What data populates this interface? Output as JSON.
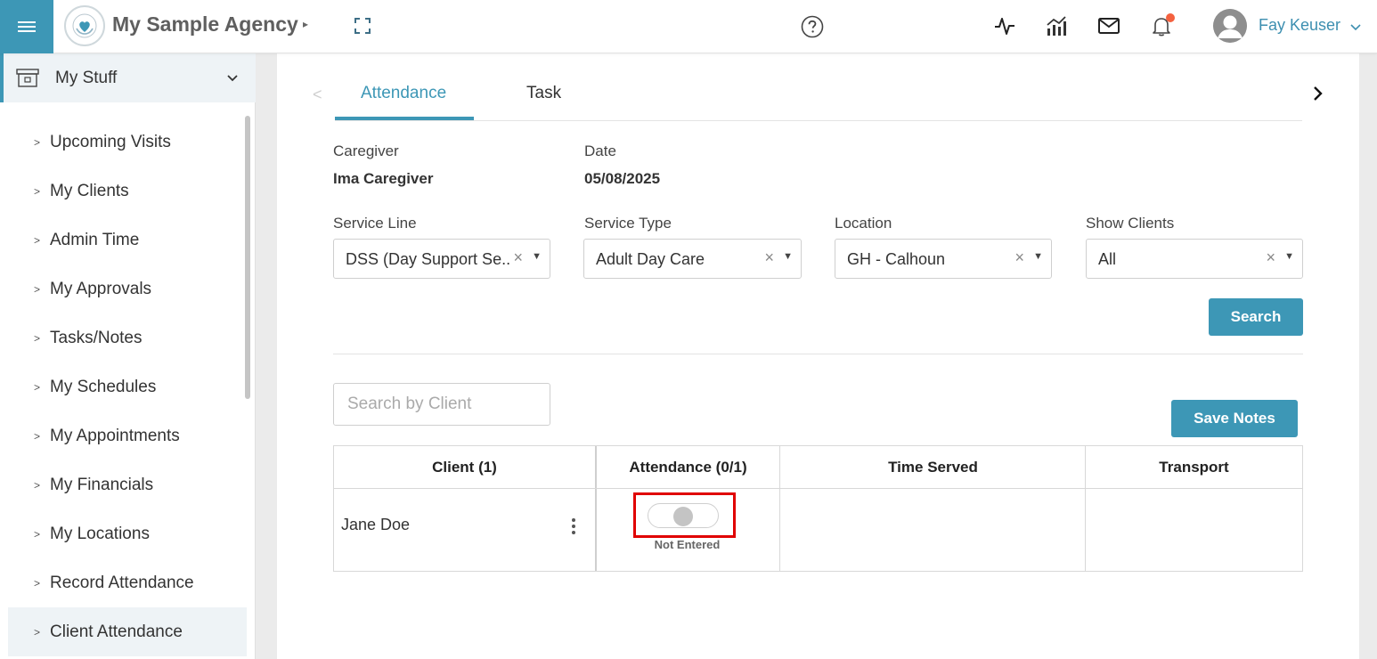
{
  "header": {
    "agency_name": "My Sample Agency",
    "user_name": "Fay Keuser",
    "accent_color": "#3d97b6",
    "notification_dot_color": "#f4613f"
  },
  "sidebar": {
    "section_label": "My Stuff",
    "items": [
      {
        "label": "Upcoming Visits"
      },
      {
        "label": "My Clients"
      },
      {
        "label": "Admin Time"
      },
      {
        "label": "My Approvals"
      },
      {
        "label": "Tasks/Notes"
      },
      {
        "label": "My Schedules"
      },
      {
        "label": "My Appointments"
      },
      {
        "label": "My Financials"
      },
      {
        "label": "My Locations"
      },
      {
        "label": "Record Attendance"
      },
      {
        "label": "Client Attendance"
      }
    ],
    "active_item": "Client Attendance"
  },
  "tabs": [
    {
      "label": "Attendance",
      "active": true
    },
    {
      "label": "Task",
      "active": false
    }
  ],
  "info": {
    "caregiver_label": "Caregiver",
    "caregiver_value": "Ima Caregiver",
    "date_label": "Date",
    "date_value": "05/08/2025"
  },
  "filters": {
    "service_line_label": "Service Line",
    "service_line_value": "DSS (Day Support Se...",
    "service_type_label": "Service Type",
    "service_type_value": "Adult Day Care",
    "location_label": "Location",
    "location_value": "GH - Calhoun",
    "show_clients_label": "Show Clients",
    "show_clients_value": "All",
    "search_button": "Search"
  },
  "client_search": {
    "placeholder": "Search by Client"
  },
  "save_notes_button": "Save Notes",
  "table": {
    "headers": [
      "Client (1)",
      "Attendance (0/1)",
      "Time Served",
      "Transport"
    ],
    "rows": [
      {
        "client": "Jane Doe",
        "attendance_status": "Not Entered",
        "time_served": "",
        "transport": ""
      }
    ]
  }
}
